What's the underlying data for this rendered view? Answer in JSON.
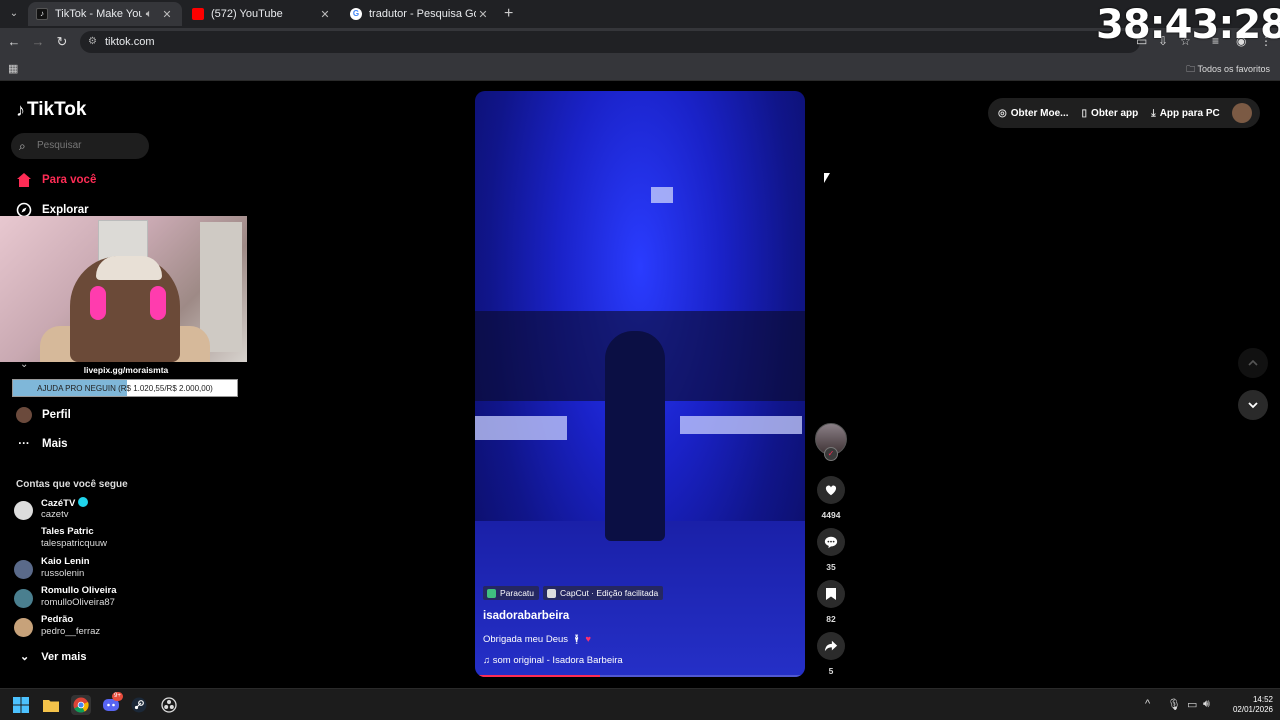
{
  "browser": {
    "tabs": [
      {
        "label": "TikTok - Make Your Day",
        "icon": "tiktok-icon",
        "active": true,
        "audio": true
      },
      {
        "label": "(572) YouTube",
        "icon": "youtube-icon",
        "active": false
      },
      {
        "label": "tradutor - Pesquisa Google",
        "icon": "google-icon",
        "active": false
      }
    ],
    "url": "tiktok.com",
    "bookmarks_all": "Todos os favoritos"
  },
  "overlay": {
    "timer": "38:43:28",
    "pix_url": "livepix.gg/moraismta",
    "goal_label": "AJUDA PRO NEGUIN (R$ 1.020,55/R$ 2.000,00)",
    "goal_progress": 0.51
  },
  "sidebar": {
    "logo": "TikTok",
    "search_placeholder": "Pesquisar",
    "nav": [
      {
        "label": "Para você",
        "active": true
      },
      {
        "label": "Explorar",
        "active": false
      },
      {
        "label": "Perfil",
        "active": false
      },
      {
        "label": "Mais",
        "active": false
      }
    ],
    "following_title": "Contas que você segue",
    "accounts": [
      {
        "name": "CazéTV",
        "user": "cazetv",
        "verified": true
      },
      {
        "name": "Tales Patric",
        "user": "talespatricquuw"
      },
      {
        "name": "Kaio Lenin",
        "user": "russolenin"
      },
      {
        "name": "Romullo Oliveira",
        "user": "romulloOliveira87"
      },
      {
        "name": "Pedrão",
        "user": "pedro__ferraz"
      }
    ],
    "see_more": "Ver mais"
  },
  "video": {
    "location_tag": "Paracatu",
    "capcut_tag": "CapCut · Edição facilitada",
    "author": "isadorabarbeira",
    "description": "Obrigada meu Deus",
    "music": "som original - Isadora Barbeira",
    "progress": 0.38
  },
  "actions": {
    "likes": "4494",
    "comments": "35",
    "saves": "82",
    "shares": "5"
  },
  "header_actions": {
    "coins": "Obter Moe...",
    "get_app": "Obter app",
    "pc_app": "App para PC"
  },
  "taskbar": {
    "time": "14:52",
    "date": "02/01/2026",
    "discord_badge": "9+"
  }
}
